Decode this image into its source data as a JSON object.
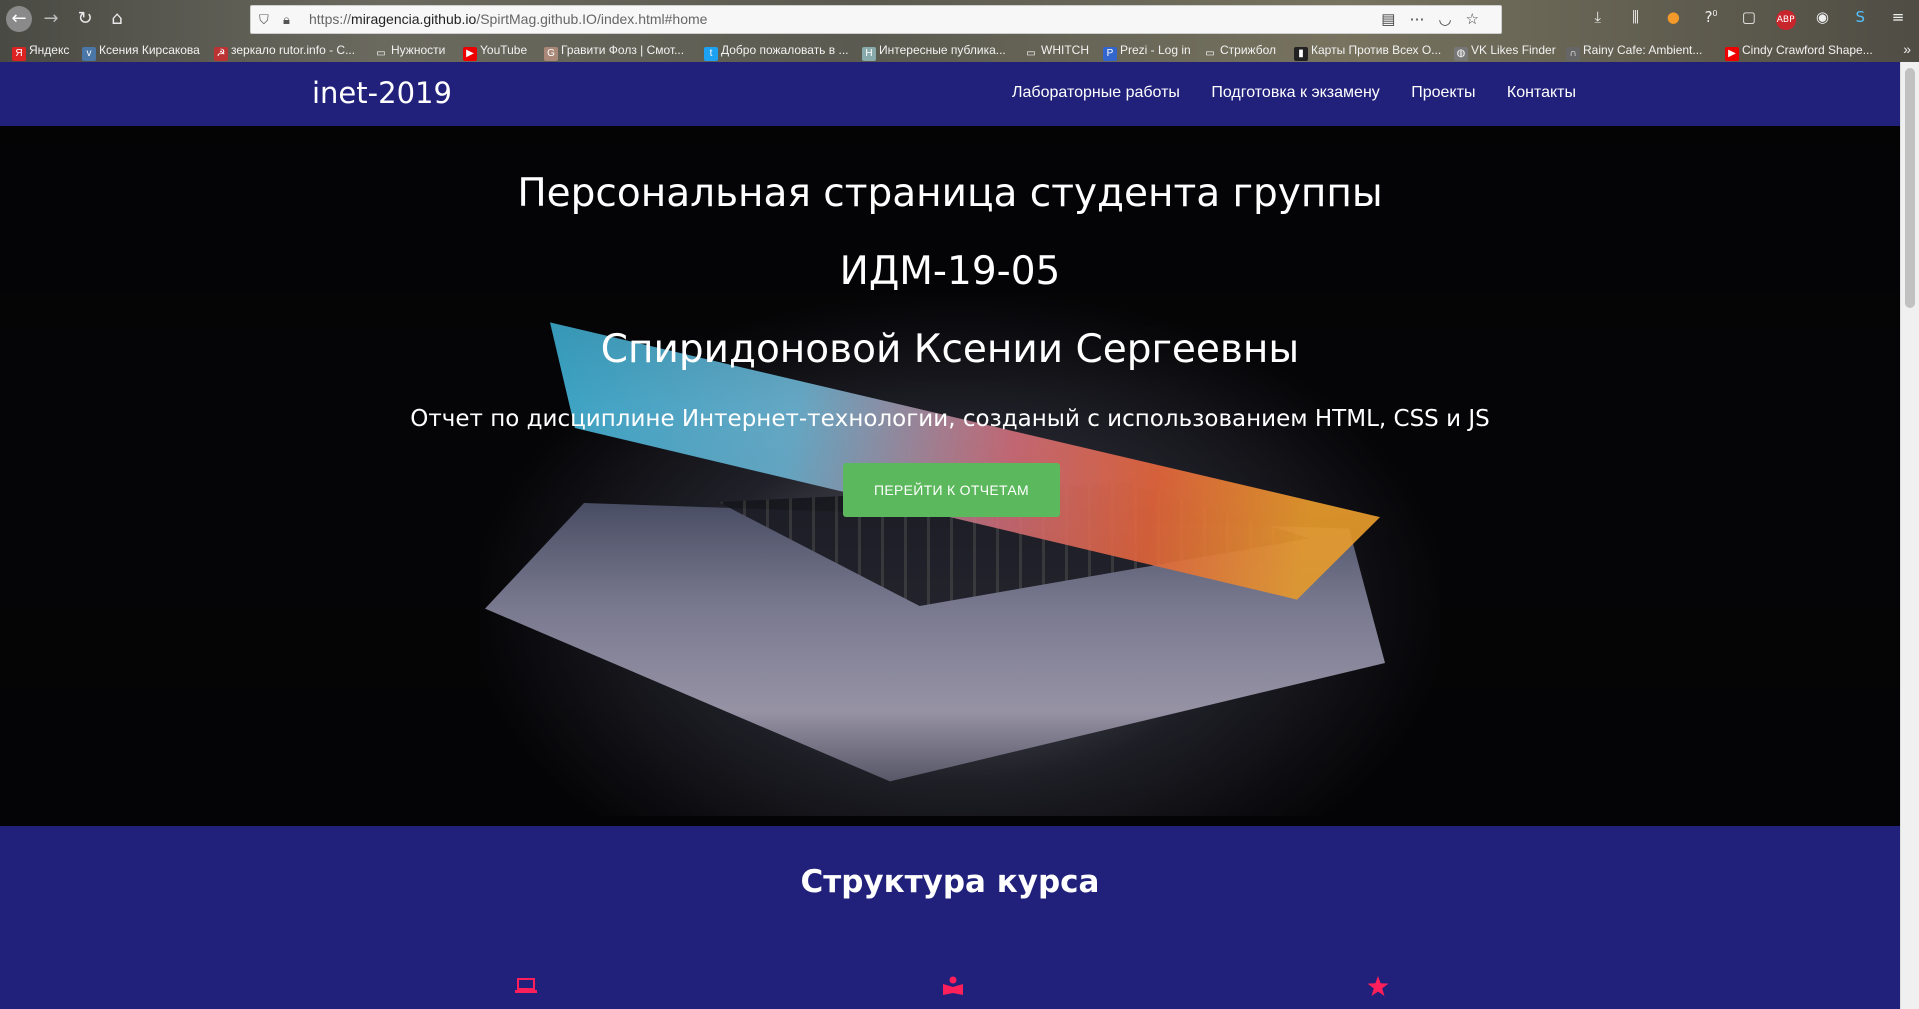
{
  "browser": {
    "url_prefix": "https://",
    "url_host": "miragencia.github.io",
    "url_path": "/SpirtMag.github.IO/index.html#home",
    "bookmarks": [
      "Яндекс",
      "Ксения Кирсакова",
      "зеркало rutor.info - С...",
      "Нужности",
      "YouTube",
      "Гравити Фолз | Смот...",
      "Добро пожаловать в ...",
      "Интересные публика...",
      "WHITCH",
      "Prezi - Log in",
      "Стрижбол",
      "Карты Против Всех О...",
      "VK Likes Finder",
      "Rainy Cafe: Ambient...",
      "Cindy Crawford Shape..."
    ],
    "badge_count": "0"
  },
  "site": {
    "brand": "inet-2019",
    "nav": [
      "Лабораторные работы",
      "Подготовка к экзамену",
      "Проекты",
      "Контакты"
    ]
  },
  "hero": {
    "line1": "Персональная страница студента группы",
    "line2": "ИДМ-19-05",
    "line3": "Спиридоновой Ксении Сергеевны",
    "subtitle": "Отчет по дисциплине Интернет-технологии, созданый с использованием HTML, CSS и JS",
    "button": "ПЕРЕЙТИ К ОТЧЕТАМ"
  },
  "structure": {
    "title": "Структура курса",
    "icons": [
      "laptop-icon",
      "book-reader-icon",
      "star-icon"
    ]
  },
  "colors": {
    "nav_bg": "#21217c",
    "button_green": "#5cb85c",
    "icon_pink": "#ff1f5a"
  }
}
